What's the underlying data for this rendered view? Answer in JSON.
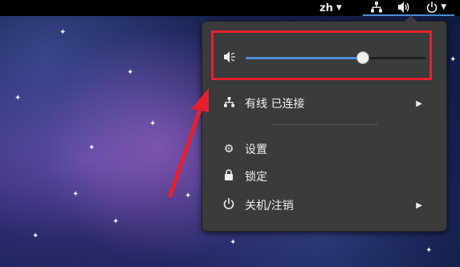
{
  "topbar": {
    "language": "zh",
    "icons": [
      "network-wired-icon",
      "speaker-icon",
      "power-icon"
    ]
  },
  "menu": {
    "volume": {
      "level": 0.65,
      "icon": "speaker-muted-icon"
    },
    "network": {
      "label": "有线 已连接",
      "icon": "network-wired-icon"
    },
    "items": [
      {
        "label": "设置",
        "icon": "gear-icon"
      },
      {
        "label": "锁定",
        "icon": "lock-icon"
      },
      {
        "label": "关机/注销",
        "icon": "power-icon"
      }
    ]
  },
  "colors": {
    "accent": "#4a90d9",
    "highlight": "#e5202e",
    "menu_bg": "#3a3b3b"
  }
}
